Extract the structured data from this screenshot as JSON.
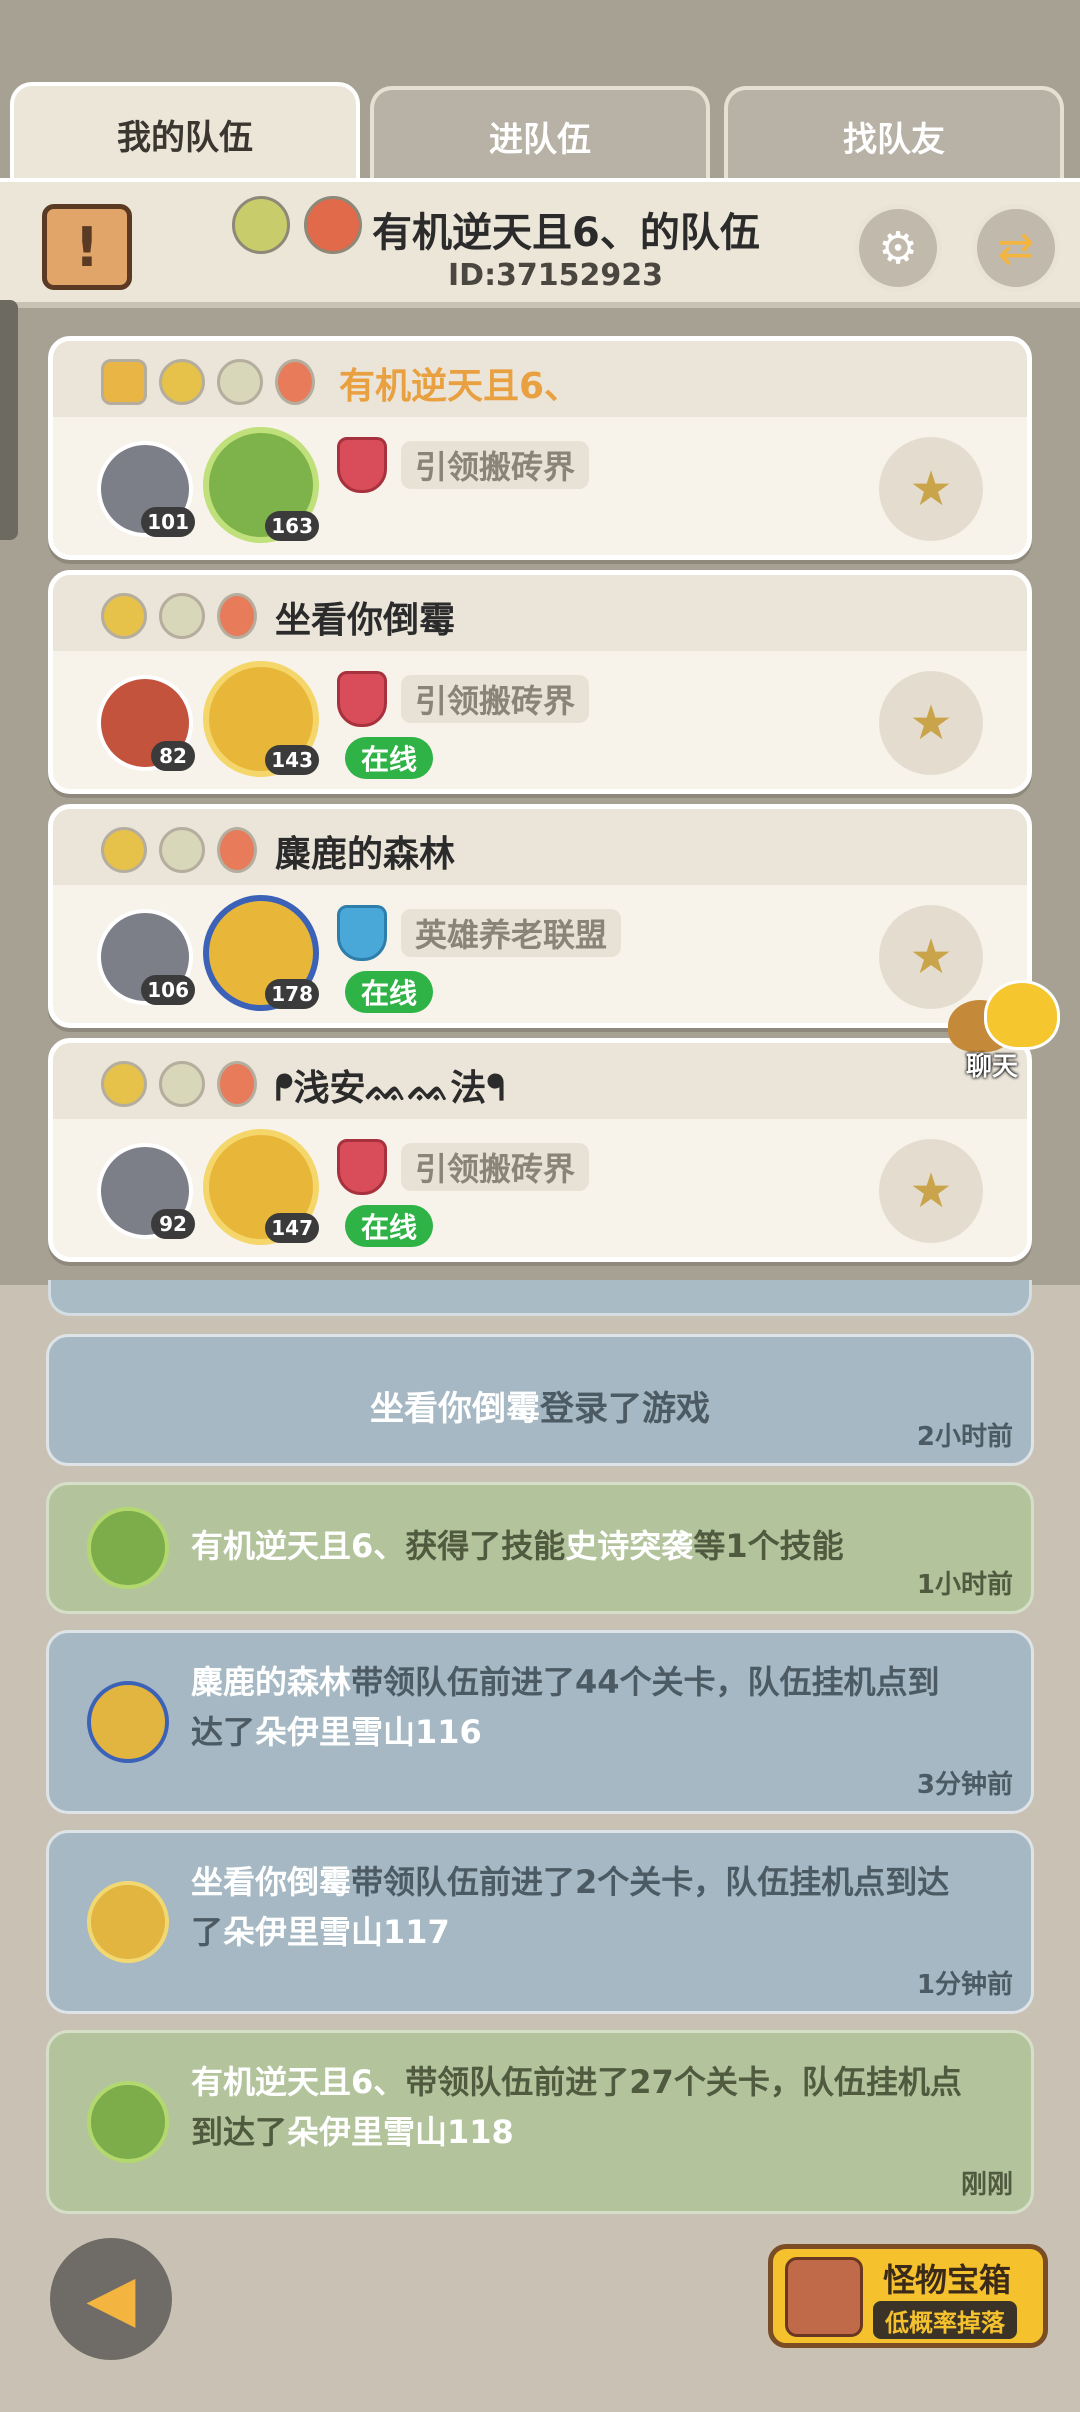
{
  "tabs": [
    {
      "label": "我的队伍"
    },
    {
      "label": "进队伍"
    },
    {
      "label": "找队友"
    }
  ],
  "header": {
    "team_title": "有机逆天且6、的队伍",
    "team_id": "ID:37152923",
    "scroll_icon_glyph": "!",
    "settings_icon": "⚙",
    "exit_icon": "⇄"
  },
  "members": [
    {
      "name": "有机逆天且6、",
      "avatar_level": "101",
      "pet_level": "163",
      "guild": "引领搬砖界",
      "online": "",
      "is_self": true
    },
    {
      "name": "坐看你倒霉",
      "avatar_level": "82",
      "pet_level": "143",
      "guild": "引领搬砖界",
      "online": "在线",
      "is_self": false
    },
    {
      "name": "麋鹿的森林",
      "avatar_level": "106",
      "pet_level": "178",
      "guild": "英雄养老联盟",
      "online": "在线",
      "is_self": false
    },
    {
      "name": "ᖰ浅安ᨐᨐ法ᖳ",
      "avatar_level": "92",
      "pet_level": "147",
      "guild": "引领搬砖界",
      "online": "在线",
      "is_self": false
    }
  ],
  "chat": {
    "label": "聊天"
  },
  "feed": [
    {
      "type": "login",
      "name": "坐看你倒霉",
      "text": "登录了游戏",
      "time": "2小时前"
    },
    {
      "type": "skill",
      "name": "有机逆天且6、",
      "text_mid": "获得了技能",
      "skill": "史诗突袭",
      "text_end": "等1个技能",
      "time": "1小时前"
    },
    {
      "type": "progress",
      "name": "麋鹿的森林",
      "text": "带领队伍前进了44个关卡，队伍挂机点到达了",
      "place": "朵伊里雪山116",
      "time": "3分钟前"
    },
    {
      "type": "progress",
      "name": "坐看你倒霉",
      "text": "带领队伍前进了2个关卡，队伍挂机点到达了",
      "place": "朵伊里雪山117",
      "time": "1分钟前"
    },
    {
      "type": "progress",
      "name": "有机逆天且6、",
      "text": "带领队伍前进了27个关卡，队伍挂机点到达了",
      "place": "朵伊里雪山118",
      "time": "刚刚"
    }
  ],
  "bottom": {
    "back_icon": "◀",
    "chest_title": "怪物宝箱",
    "chest_subtitle": "低概率掉落"
  }
}
